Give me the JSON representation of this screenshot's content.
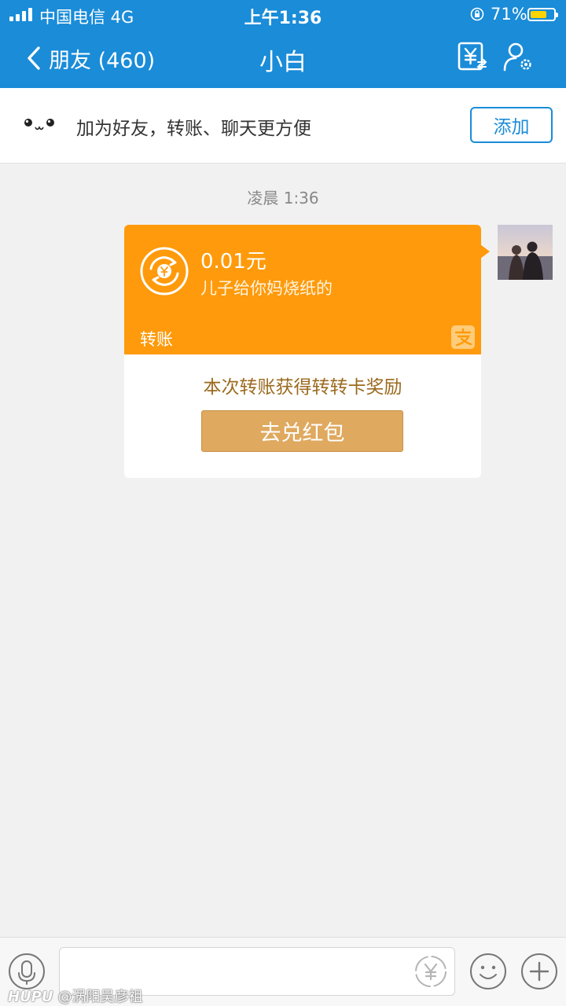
{
  "status_bar": {
    "carrier": "中国电信  4G",
    "time": "上午1:36",
    "battery_percent": "71%",
    "battery_level": 0.71
  },
  "nav": {
    "back_label": "朋友 (460)",
    "title": "小白",
    "icons": [
      "transfer-record-icon",
      "profile-settings-icon"
    ]
  },
  "banner": {
    "text": "加为好友，转账、聊天更方便",
    "add_label": "添加"
  },
  "chat": {
    "timestamp": "凌晨 1:36",
    "transfer": {
      "amount": "0.01元",
      "memo": "儿子给你妈烧纸的",
      "type_label": "转账",
      "reward_text": "本次转账获得转转卡奖励",
      "redeem_label": "去兑红包"
    }
  },
  "input_bar": {
    "icons": [
      "microphone-icon",
      "yuan-icon",
      "emoji-icon",
      "plus-icon"
    ]
  },
  "watermark": {
    "logo": "HUPU",
    "text": "@涡阳吴彦祖"
  },
  "colors": {
    "nav_blue": "#1a8cd8",
    "transfer_orange": "#fe9a0b",
    "redeem_gold": "#dfa95f",
    "reward_brown": "#9b6a1e"
  }
}
